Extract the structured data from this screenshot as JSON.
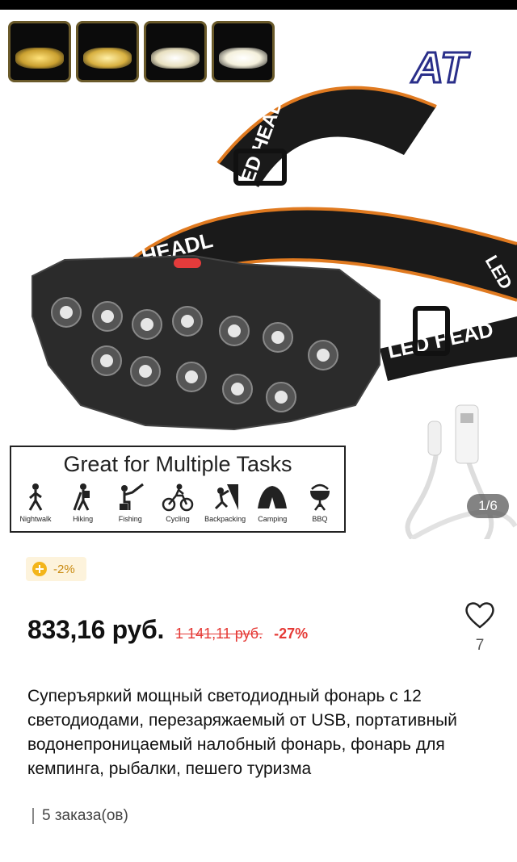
{
  "gallery": {
    "counter": "1/6",
    "logo_text": "AT",
    "banner_title": "Great for Multiple Tasks",
    "activities": [
      {
        "label": "Nightwalk",
        "icon": "walker-icon"
      },
      {
        "label": "Hiking",
        "icon": "hiker-icon"
      },
      {
        "label": "Fishing",
        "icon": "fishing-icon"
      },
      {
        "label": "Cycling",
        "icon": "cyclist-icon"
      },
      {
        "label": "Backpacking",
        "icon": "climber-icon"
      },
      {
        "label": "Camping",
        "icon": "tent-icon"
      },
      {
        "label": "BBQ",
        "icon": "grill-icon"
      }
    ],
    "strap_text": [
      "LED HEADLIGHT",
      "HEADL",
      "LED HEAD",
      "LED"
    ]
  },
  "coupon": {
    "text": "-2%",
    "color": "#f3b51b"
  },
  "price": {
    "current": "833,16 руб.",
    "old": "1 141,11 руб.",
    "discount": "-27%",
    "accent": "#e53935"
  },
  "wishlist": {
    "count": "7"
  },
  "product": {
    "title": "Суперъяркий мощный светодиодный фонарь с 12 светодиодами, перезаряжаемый от USB, портативный водонепроницаемый налобный фонарь, фонарь для кемпинга, рыбалки, пешего туризма",
    "orders": "5 заказа(ов)"
  }
}
